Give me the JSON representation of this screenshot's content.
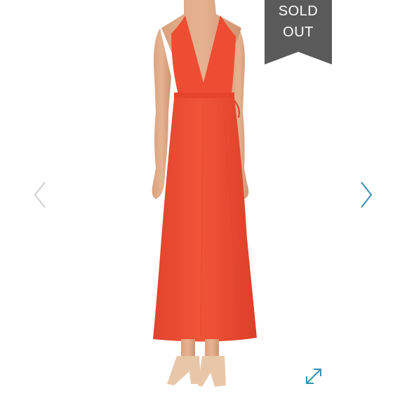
{
  "gallery": {
    "product_image": "red-halter-wrap-maxi-dress",
    "prev_icon": "chevron-left-icon",
    "next_icon": "chevron-right-icon",
    "expand_icon": "expand-icon",
    "colors": {
      "dress": "#ec4a32",
      "arrow_disabled": "#d0d0d0",
      "arrow_active": "#3a8fb7",
      "badge": "#5a5a5a"
    }
  },
  "badge": {
    "line1": "SOLD",
    "line2": "OUT"
  }
}
